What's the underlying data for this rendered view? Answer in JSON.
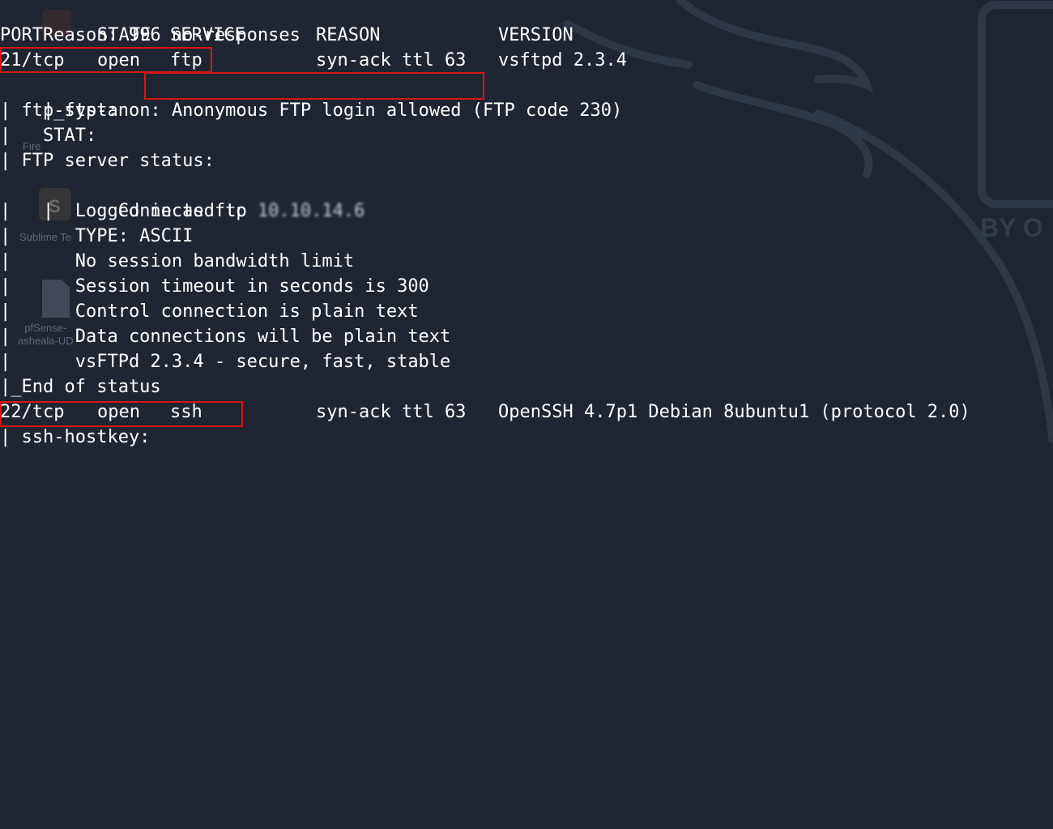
{
  "terminal": {
    "lines": [
      {
        "text": "Reason: 996 no-responses"
      },
      {
        "port": "PORT",
        "state": "STATE",
        "service": "SERVICE",
        "reason": "REASON",
        "version": "VERSION"
      },
      {
        "port": "21/tcp",
        "state": "open",
        "service": "ftp",
        "reason": "syn-ack ttl 63",
        "version": "vsftpd 2.3.4"
      },
      {
        "prefix": "|_ftp-anon: ",
        "highlight": "Anonymous FTP login allowed",
        "suffix": " (FTP code 230)"
      },
      {
        "text": "| ftp-syst: "
      },
      {
        "text": "|   STAT: "
      },
      {
        "text": "| FTP server status:"
      },
      {
        "prefix": "|      Connected to ",
        "redacted": "10.10.14.6"
      },
      {
        "text": "|      Logged in as ftp"
      },
      {
        "text": "|      TYPE: ASCII"
      },
      {
        "text": "|      No session bandwidth limit"
      },
      {
        "text": "|      Session timeout in seconds is 300"
      },
      {
        "text": "|      Control connection is plain text"
      },
      {
        "text": "|      Data connections will be plain text"
      },
      {
        "text": "|      vsFTPd 2.3.4 - secure, fast, stable"
      },
      {
        "text": "|_End of status"
      },
      {
        "port": "22/tcp",
        "state": "open",
        "service": "ssh",
        "reason": "syn-ack ttl 63",
        "version": "OpenSSH 4.7p1 Debian 8ubuntu1 (protocol 2.0)"
      },
      {
        "text": "| ssh-hostkey: "
      }
    ]
  },
  "desktop": {
    "icons": [
      {
        "label": "Fire",
        "icon": "firefox-icon"
      },
      {
        "label": "Sublime Te",
        "icon": "sublime-text-icon"
      },
      {
        "label": "pfSense-\nasheala-UD",
        "icon": "file-icon"
      }
    ],
    "watermark": "BY O"
  },
  "colors": {
    "background": "#1f2631",
    "text": "#ffffff",
    "highlight_box": "#d81418"
  }
}
